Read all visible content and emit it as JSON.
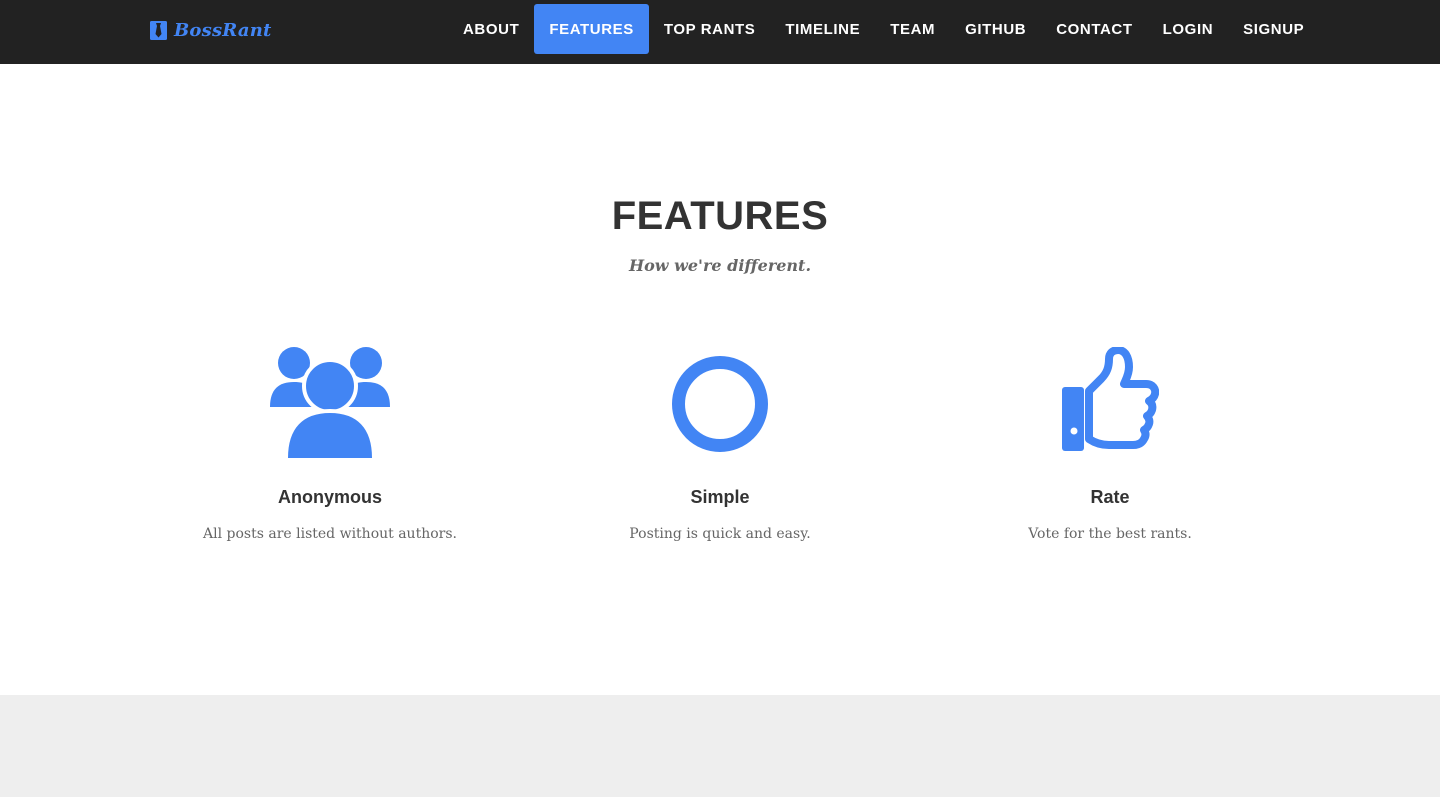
{
  "colors": {
    "accent": "#4285f4",
    "navbar_bg": "#222222",
    "heading": "#333333",
    "muted_text": "#666666",
    "band_bg": "#eeeeee"
  },
  "brand": {
    "name": "BossRant",
    "icon": "tie-icon"
  },
  "nav": {
    "items": [
      {
        "label": "ABOUT",
        "active": false
      },
      {
        "label": "FEATURES",
        "active": true
      },
      {
        "label": "TOP RANTS",
        "active": false
      },
      {
        "label": "TIMELINE",
        "active": false
      },
      {
        "label": "TEAM",
        "active": false
      },
      {
        "label": "GITHUB",
        "active": false
      },
      {
        "label": "CONTACT",
        "active": false
      },
      {
        "label": "LOGIN",
        "active": false
      },
      {
        "label": "SIGNUP",
        "active": false
      }
    ]
  },
  "features_section": {
    "heading": "FEATURES",
    "subheading": "How we're different.",
    "items": [
      {
        "icon": "users-icon",
        "title": "Anonymous",
        "text": "All posts are listed without authors."
      },
      {
        "icon": "circle-icon",
        "title": "Simple",
        "text": "Posting is quick and easy."
      },
      {
        "icon": "thumbs-up-icon",
        "title": "Rate",
        "text": "Vote for the best rants."
      }
    ]
  }
}
